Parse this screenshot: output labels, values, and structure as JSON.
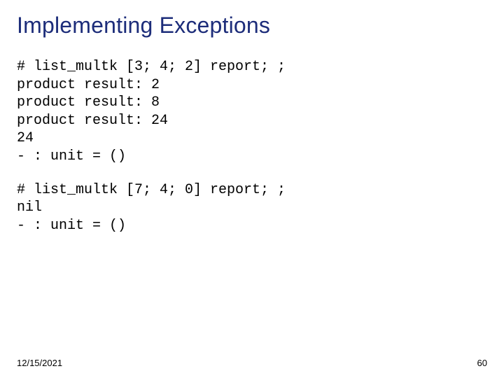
{
  "title": "Implementing Exceptions",
  "code1": "# list_multk [3; 4; 2] report; ;\nproduct result: 2\nproduct result: 8\nproduct result: 24\n24\n- : unit = ()",
  "code2": "# list_multk [7; 4; 0] report; ;\nnil\n- : unit = ()",
  "footer": {
    "date": "12/15/2021",
    "page": "60"
  }
}
